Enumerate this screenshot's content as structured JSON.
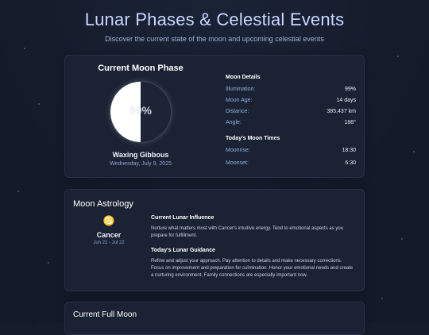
{
  "header": {
    "title": "Lunar Phases & Celestial Events",
    "subtitle": "Discover the current state of the moon and upcoming celestial events"
  },
  "current": {
    "heading": "Current Moon Phase",
    "illumination_display": "99%",
    "illumination_fraction": 0.5,
    "phase_name": "Waxing Gibbous",
    "date": "Wednesday, July 9, 2025"
  },
  "details": {
    "heading": "Moon Details",
    "rows": [
      {
        "label": "Illumination:",
        "value": "99%"
      },
      {
        "label": "Moon Age:",
        "value": "14 days"
      },
      {
        "label": "Distance:",
        "value": "385,437 km"
      },
      {
        "label": "Angle:",
        "value": "188°"
      }
    ],
    "times_heading": "Today's Moon Times",
    "times": [
      {
        "label": "Moonrise:",
        "value": "18:30"
      },
      {
        "label": "Moonset:",
        "value": "6:30"
      }
    ]
  },
  "astrology": {
    "heading": "Moon Astrology",
    "sign_icon": "cancer-symbol-icon",
    "sign_glyph": "♋",
    "sign": "Cancer",
    "sign_dates": "Jun 21 - Jul 22",
    "influence_heading": "Current Lunar Influence",
    "influence_text": "Nurture what matters most with Cancer's intuitive energy. Tend to emotional aspects as you prepare for fulfillment.",
    "guidance_heading": "Today's Lunar Guidance",
    "guidance_text": "Refine and adjust your approach. Pay attention to details and make necessary corrections. Focus on improvement and preparation for culmination. Honor your emotional needs and create a nurturing environment. Family connections are especially important now."
  },
  "full_moon": {
    "heading": "Current Full Moon"
  }
}
